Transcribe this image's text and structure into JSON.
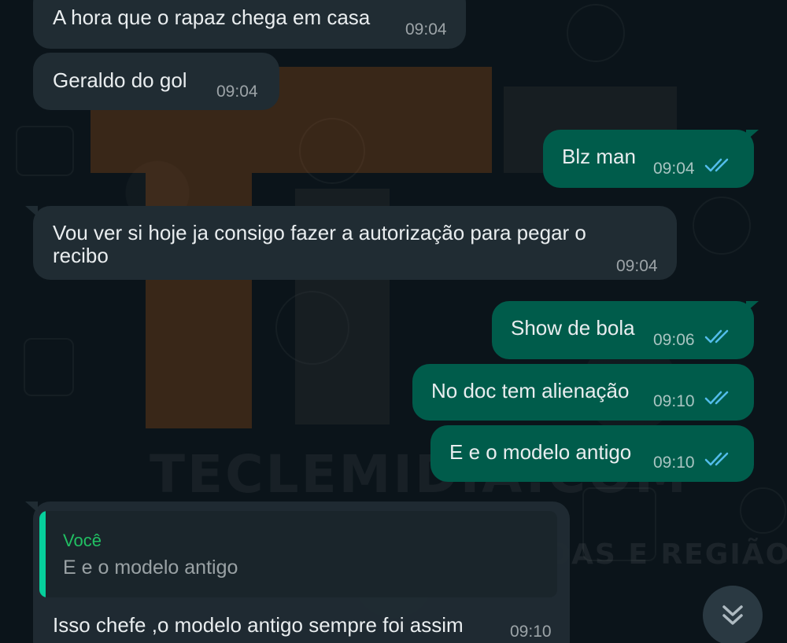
{
  "messages": [
    {
      "text": "A hora que o rapaz chega em casa",
      "time": "09:04"
    },
    {
      "text": "Geraldo do gol",
      "time": "09:04"
    },
    {
      "text": "Blz man",
      "time": "09:04"
    },
    {
      "line1": "Vou ver si hoje ja consigo fazer a autorização para pegar o",
      "line2": "recibo",
      "time": "09:04"
    },
    {
      "text": "Show de bola",
      "time": "09:06"
    },
    {
      "text": "No doc tem alienação",
      "time": "09:10"
    },
    {
      "text": "E e o modelo antigo",
      "time": "09:10"
    },
    {
      "quote_author": "Você",
      "quote_text": "E e o modelo antigo",
      "text": "Isso chefe ,o modelo antigo sempre foi assim",
      "time": "09:10"
    }
  ],
  "watermark": {
    "title": "TECLEMIDIA.COM",
    "subtitle": "NOTÍCIAS DE SETE LAGOAS E REGIÃO"
  },
  "colors": {
    "incoming": "#202c33",
    "outgoing": "#005c4b",
    "read_ticks": "#53bdeb",
    "quote_author": "#21c063"
  },
  "icons": {
    "read_receipt": "double-check-icon",
    "scroll_down": "double-chevron-down-icon"
  }
}
